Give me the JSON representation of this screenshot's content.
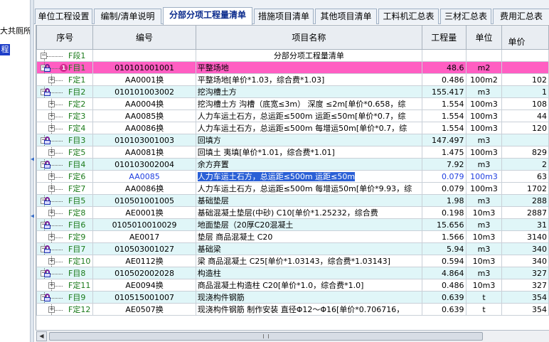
{
  "left_panel": {
    "partial_text": "大共厕所",
    "selected_text": "程"
  },
  "tabs": [
    {
      "label": "单位工程设置",
      "active": false
    },
    {
      "label": "编制/清单说明",
      "active": false
    },
    {
      "label": "分部分项工程量清单",
      "active": true
    },
    {
      "label": "措施项目清单",
      "active": false
    },
    {
      "label": "其他项目清单",
      "active": false
    },
    {
      "label": "工料机汇总表",
      "active": false
    },
    {
      "label": "三材汇总表",
      "active": false
    },
    {
      "label": "费用汇总表",
      "active": false
    }
  ],
  "columns": {
    "seq": "序号",
    "code": "编号",
    "name": "项目名称",
    "qty": "工程量",
    "unit": "单位",
    "price": "单价"
  },
  "rows": [
    {
      "seq": "F段1",
      "code": "",
      "name": "分部分项工程量清单",
      "qty": "",
      "unit": "",
      "price": "",
      "type": "fen"
    },
    {
      "seq": "F目1",
      "code": "010101001001",
      "name": "平整场地",
      "qty": "48.6",
      "unit": "m2",
      "price": "",
      "type": "qd",
      "pink": true,
      "badge": "1"
    },
    {
      "seq": "F定1",
      "code": "AA0001换",
      "name": "平整场地[单价*1.03，综合费*1.03]",
      "qty": "0.486",
      "unit": "100m2",
      "price": "102",
      "type": "de"
    },
    {
      "seq": "F目2",
      "code": "010101003002",
      "name": "挖沟槽土方",
      "qty": "155.417",
      "unit": "m3",
      "price": "1",
      "type": "qd"
    },
    {
      "seq": "F定2",
      "code": "AA0004换",
      "name": "挖沟槽土方 沟槽（底宽≤3m） 深度 ≤2m[单价*0.658，综",
      "qty": "1.554",
      "unit": "100m3",
      "price": "108",
      "type": "de"
    },
    {
      "seq": "F定3",
      "code": "AA0085换",
      "name": "人力车运土石方，总运距≤500m 运距≤50m[单价*0.7，综",
      "qty": "1.554",
      "unit": "100m3",
      "price": "44",
      "type": "de"
    },
    {
      "seq": "F定4",
      "code": "AA0086换",
      "name": "人力车运土石方，总运距≤500m 每增运50m[单价*0.7，综",
      "qty": "1.554",
      "unit": "100m3",
      "price": "120",
      "type": "de"
    },
    {
      "seq": "F目3",
      "code": "010103001003",
      "name": "回填方",
      "qty": "147.497",
      "unit": "m3",
      "price": "",
      "type": "qd"
    },
    {
      "seq": "F定5",
      "code": "AA0081换",
      "name": "回填土 夷填[单价*1.01，综合费*1.01]",
      "qty": "1.475",
      "unit": "100m3",
      "price": "829",
      "type": "de"
    },
    {
      "seq": "F目4",
      "code": "010103002004",
      "name": "余方弃置",
      "qty": "7.92",
      "unit": "m3",
      "price": "2",
      "type": "qd"
    },
    {
      "seq": "F定6",
      "code": "AA0085",
      "name": "人力车运土石方，总运距≤500m 运距≤50m",
      "qty": "0.079",
      "unit": "100m3",
      "price": "63",
      "type": "de",
      "selected": true
    },
    {
      "seq": "F定7",
      "code": "AA0086换",
      "name": "人力车运土石方，总运距≤500m 每增运50m[单价*9.93，综",
      "qty": "0.079",
      "unit": "100m3",
      "price": "1702",
      "type": "de"
    },
    {
      "seq": "F目5",
      "code": "010501001005",
      "name": "基础垫层",
      "qty": "1.98",
      "unit": "m3",
      "price": "288",
      "type": "qd"
    },
    {
      "seq": "F定8",
      "code": "AE0001换",
      "name": "基础混凝土垫层(中砂) C10[单价*1.25232，综合费",
      "qty": "0.198",
      "unit": "10m3",
      "price": "2887",
      "type": "de"
    },
    {
      "seq": "F目6",
      "code": "0105010010029",
      "name": "地面垫层（20厚C20混凝土",
      "qty": "15.656",
      "unit": "m3",
      "price": "31",
      "type": "qd"
    },
    {
      "seq": "F定9",
      "code": "AE0017",
      "name": "垫层 商品混凝土 C20",
      "qty": "1.566",
      "unit": "10m3",
      "price": "3140",
      "type": "de"
    },
    {
      "seq": "F目7",
      "code": "010503001027",
      "name": "基础梁",
      "qty": "5.94",
      "unit": "m3",
      "price": "340",
      "type": "qd"
    },
    {
      "seq": "F定10",
      "code": "AE0112换",
      "name": "梁 商品混凝土 C25[单价*1.03143，综合费*1.03143]",
      "qty": "0.594",
      "unit": "10m3",
      "price": "340",
      "type": "de"
    },
    {
      "seq": "F目8",
      "code": "010502002028",
      "name": "构造柱",
      "qty": "4.864",
      "unit": "m3",
      "price": "327",
      "type": "qd"
    },
    {
      "seq": "F定11",
      "code": "AE0094换",
      "name": "商品混凝土构造柱 C20[单价*1.0，综合费*1.0]",
      "qty": "0.486",
      "unit": "10m3",
      "price": "327",
      "type": "de"
    },
    {
      "seq": "F目9",
      "code": "010515001007",
      "name": "现浇构件钢筋",
      "qty": "0.639",
      "unit": "t",
      "price": "354",
      "type": "qd"
    },
    {
      "seq": "F定12",
      "code": "AE0507换",
      "name": "现浇构件钢筋 制作安装 直径Φ12～Φ16[单价*0.706716，",
      "qty": "0.639",
      "unit": "t",
      "price": "354",
      "type": "de"
    }
  ]
}
